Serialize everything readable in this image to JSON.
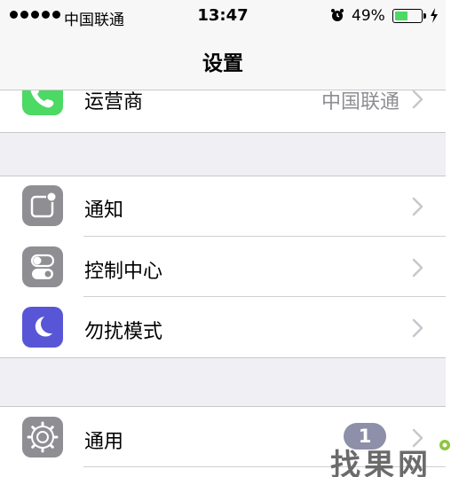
{
  "status": {
    "carrier": "中国联通",
    "time": "13:47",
    "battery_percent": "49%",
    "battery_level": 0.49
  },
  "nav": {
    "title": "设置"
  },
  "rows": {
    "carrier": {
      "label": "运营商",
      "detail": "中国联通"
    },
    "notifications": {
      "label": "通知"
    },
    "control_center": {
      "label": "控制中心"
    },
    "do_not_disturb": {
      "label": "勿扰模式"
    },
    "general": {
      "label": "通用",
      "badge": "1"
    }
  },
  "icons": {
    "carrier": {
      "name": "phone-icon",
      "color": "#4cd964"
    },
    "notifications": {
      "name": "notifications-icon",
      "color": "#8e8e93"
    },
    "control_center": {
      "name": "control-center-icon",
      "color": "#8e8e93"
    },
    "do_not_disturb": {
      "name": "moon-icon",
      "color": "#5856d6"
    },
    "general": {
      "name": "gear-icon",
      "color": "#8e8e93"
    }
  },
  "watermark": {
    "text": "找果网"
  }
}
